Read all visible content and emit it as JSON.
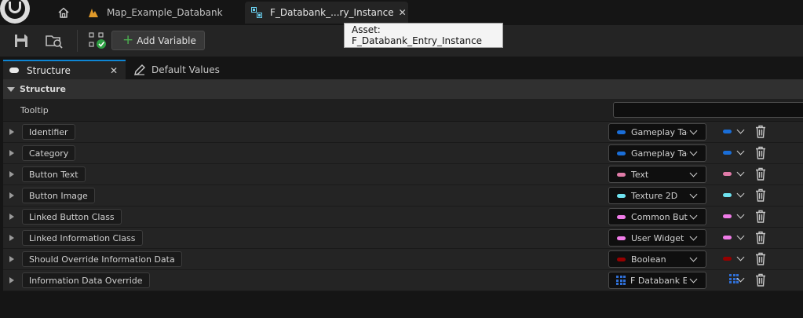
{
  "tabs": {
    "map_tab": "Map_Example_Databank",
    "active_tab": "F_Databank_...ry_Instance",
    "tooltip": "Asset: F_Databank_Entry_Instance"
  },
  "toolbar": {
    "add_variable": "Add Variable"
  },
  "panel_tabs": {
    "structure": "Structure",
    "defaults": "Default Values"
  },
  "section": {
    "title": "Structure",
    "tooltip_label": "Tooltip"
  },
  "variables": [
    {
      "name": "Identifier",
      "type": "Gameplay Tag",
      "color": "#1a6ed8"
    },
    {
      "name": "Category",
      "type": "Gameplay Tag",
      "color": "#1a6ed8"
    },
    {
      "name": "Button Text",
      "type": "Text",
      "color": "#e07ba8"
    },
    {
      "name": "Button Image",
      "type": "Texture 2D",
      "color": "#6fe3f0"
    },
    {
      "name": "Linked Button Class",
      "type": "Common Button",
      "color": "#f07ce8"
    },
    {
      "name": "Linked Information Class",
      "type": "User Widget",
      "color": "#f07ce8"
    },
    {
      "name": "Should Override Information Data",
      "type": "Boolean",
      "color": "#950000"
    },
    {
      "name": "Information Data Override",
      "type": "F Databank Entry",
      "color": "#2f6fd6"
    }
  ]
}
